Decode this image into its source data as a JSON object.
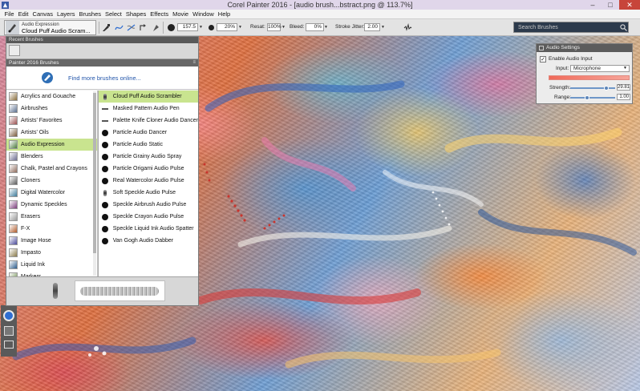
{
  "window": {
    "title": "Corel Painter 2016 - [audio brush...bstract.png @ 113.7%]",
    "controls": {
      "minimize": "–",
      "maximize": "□",
      "close": "✕"
    }
  },
  "menu": [
    "File",
    "Edit",
    "Canvas",
    "Layers",
    "Brushes",
    "Select",
    "Shapes",
    "Effects",
    "Movie",
    "Window",
    "Help"
  ],
  "property_bar": {
    "brush_category": "Audio Expression",
    "brush_variant": "Cloud Puff Audio Scram...",
    "size_value": "157.5",
    "opacity_value": "20%",
    "resat_label": "Resat:",
    "resat_value": "100%",
    "bleed_label": "Bleed:",
    "bleed_value": "0%",
    "stroke_jitter_label": "Stroke Jitter:",
    "stroke_jitter_value": "2.00",
    "search_placeholder": "Search Brushes"
  },
  "brush_library": {
    "recent_title": "Recent Brushes",
    "library_title": "Painter 2016 Brushes",
    "find_more": "Find more brushes online...",
    "categories": [
      {
        "label": "Acrylics and Gouache",
        "selected": false
      },
      {
        "label": "Airbrushes",
        "selected": false
      },
      {
        "label": "Artists' Favorites",
        "selected": false
      },
      {
        "label": "Artists' Oils",
        "selected": false
      },
      {
        "label": "Audio Expression",
        "selected": true
      },
      {
        "label": "Blenders",
        "selected": false
      },
      {
        "label": "Chalk, Pastel and Crayons",
        "selected": false
      },
      {
        "label": "Cloners",
        "selected": false
      },
      {
        "label": "Digital Watercolor",
        "selected": false
      },
      {
        "label": "Dynamic Speckles",
        "selected": false
      },
      {
        "label": "Erasers",
        "selected": false
      },
      {
        "label": "F-X",
        "selected": false
      },
      {
        "label": "Image Hose",
        "selected": false
      },
      {
        "label": "Impasto",
        "selected": false
      },
      {
        "label": "Liquid Ink",
        "selected": false
      },
      {
        "label": "Markers",
        "selected": false
      }
    ],
    "variants": [
      {
        "label": "Cloud Puff Audio Scrambler",
        "selected": true,
        "icon": "soft"
      },
      {
        "label": "Masked Pattern Audio Pen",
        "selected": false,
        "icon": "dash"
      },
      {
        "label": "Palette Knife Cloner Audio Dancer",
        "selected": false,
        "icon": "dash"
      },
      {
        "label": "Particle Audio Dancer",
        "selected": false,
        "icon": "dot"
      },
      {
        "label": "Particle Audio Static",
        "selected": false,
        "icon": "dot"
      },
      {
        "label": "Particle Grainy Audio Spray",
        "selected": false,
        "icon": "dot"
      },
      {
        "label": "Particle Origami Audio Pulse",
        "selected": false,
        "icon": "dot"
      },
      {
        "label": "Real Watercolor Audio Pulse",
        "selected": false,
        "icon": "dot"
      },
      {
        "label": "Soft Speckle Audio Pulse",
        "selected": false,
        "icon": "soft"
      },
      {
        "label": "Speckle Airbrush Audio Pulse",
        "selected": false,
        "icon": "dot"
      },
      {
        "label": "Speckle Crayon Audio Pulse",
        "selected": false,
        "icon": "dot"
      },
      {
        "label": "Speckle Liquid Ink Audio Spatter",
        "selected": false,
        "icon": "dot"
      },
      {
        "label": "Van Gogh Audio Dabber",
        "selected": false,
        "icon": "dot"
      }
    ]
  },
  "audio_settings": {
    "title": "Audio Settings",
    "enable_label": "Enable Audio Input",
    "enable_checked": "✓",
    "input_label": "Input:",
    "input_value": "Microphone",
    "strength_label": "Strength:",
    "strength_value": "29.81",
    "strength_fraction": 0.8,
    "range_label": "Range:",
    "range_value": "1.00",
    "range_fraction": 0.38
  },
  "colors": {
    "selection_green": "#c9e48f",
    "link_blue": "#2255aa",
    "close_red": "#c7453a",
    "main_color": "#2f6ed1"
  }
}
